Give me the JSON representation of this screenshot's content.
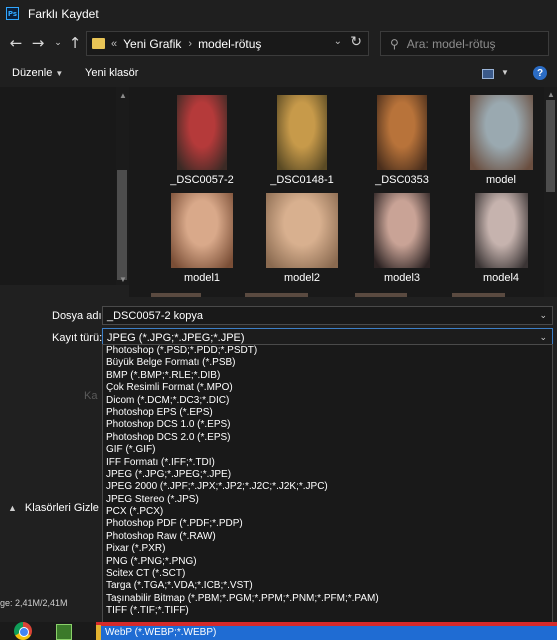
{
  "window": {
    "app_icon": "photoshop-icon",
    "title": "Farklı Kaydet"
  },
  "navigation": {
    "back_icon": "back-arrow-icon",
    "forward_icon": "forward-arrow-icon",
    "recent_icon": "chevron-down-icon",
    "up_icon": "up-arrow-icon",
    "breadcrumb": [
      "Yeni Grafik",
      "model-rötuş"
    ],
    "breadcrumb_prefix": "«",
    "separator": "›",
    "search_placeholder": "Ara: model-rötuş"
  },
  "toolbar": {
    "organize_label": "Düzenle",
    "new_folder_label": "Yeni klasör"
  },
  "files": [
    {
      "name": "_DSC0057-2",
      "colors": [
        "#b53a3a",
        "#3b2a25"
      ]
    },
    {
      "name": "_DSC0148-1",
      "colors": [
        "#c79a4a",
        "#5a4a24"
      ]
    },
    {
      "name": "_DSC0353",
      "colors": [
        "#b8733a",
        "#4a2e1c"
      ]
    },
    {
      "name": "model",
      "colors": [
        "#9aa9b0",
        "#6a4e3f"
      ]
    },
    {
      "name": "model1",
      "colors": [
        "#d9a98a",
        "#7a4e36"
      ]
    },
    {
      "name": "model2",
      "colors": [
        "#d8b08f",
        "#8a6a50"
      ]
    },
    {
      "name": "model3",
      "colors": [
        "#c9a396",
        "#2b2222"
      ]
    },
    {
      "name": "model4",
      "colors": [
        "#c6b3ae",
        "#3a3434"
      ]
    }
  ],
  "form": {
    "filename_label": "Dosya adı:",
    "filename_value": "_DSC0057-2 kopya",
    "filetype_label": "Kayıt türü:",
    "filetype_value": "JPEG (*.JPG;*.JPEG;*.JPE)",
    "hidden_label": "Ka",
    "hide_folders_label": "Klasörleri Gizle",
    "status_text": "ge: 2,41M/2,41M"
  },
  "filetype_options": [
    "Photoshop (*.PSD;*.PDD;*.PSDT)",
    "Büyük Belge Formatı (*.PSB)",
    "BMP (*.BMP;*.RLE;*.DIB)",
    "Çok Resimli Format (*.MPO)",
    "Dicom (*.DCM;*.DC3;*.DIC)",
    "Photoshop EPS (*.EPS)",
    "Photoshop DCS 1.0 (*.EPS)",
    "Photoshop DCS 2.0 (*.EPS)",
    "GIF (*.GIF)",
    "IFF Formatı (*.IFF;*.TDI)",
    "JPEG (*.JPG;*.JPEG;*.JPE)",
    "JPEG 2000 (*.JPF;*.JPX;*.JP2;*.J2C;*.J2K;*.JPC)",
    "JPEG Stereo (*.JPS)",
    "PCX (*.PCX)",
    "Photoshop PDF (*.PDF;*.PDP)",
    "Photoshop Raw (*.RAW)",
    "Pixar (*.PXR)",
    "PNG (*.PNG;*.PNG)",
    "Scitex CT (*.SCT)",
    "Targa (*.TGA;*.VDA;*.ICB;*.VST)",
    "Taşınabilir Bitmap (*.PBM;*.PGM;*.PPM;*.PNM;*.PFM;*.PAM)",
    "TIFF (*.TIF;*.TIFF)"
  ],
  "selected_option": "WebP (*.WEBP;*.WEBP)",
  "taskbar": {
    "apps": [
      "chrome-icon",
      "app-icon"
    ]
  }
}
